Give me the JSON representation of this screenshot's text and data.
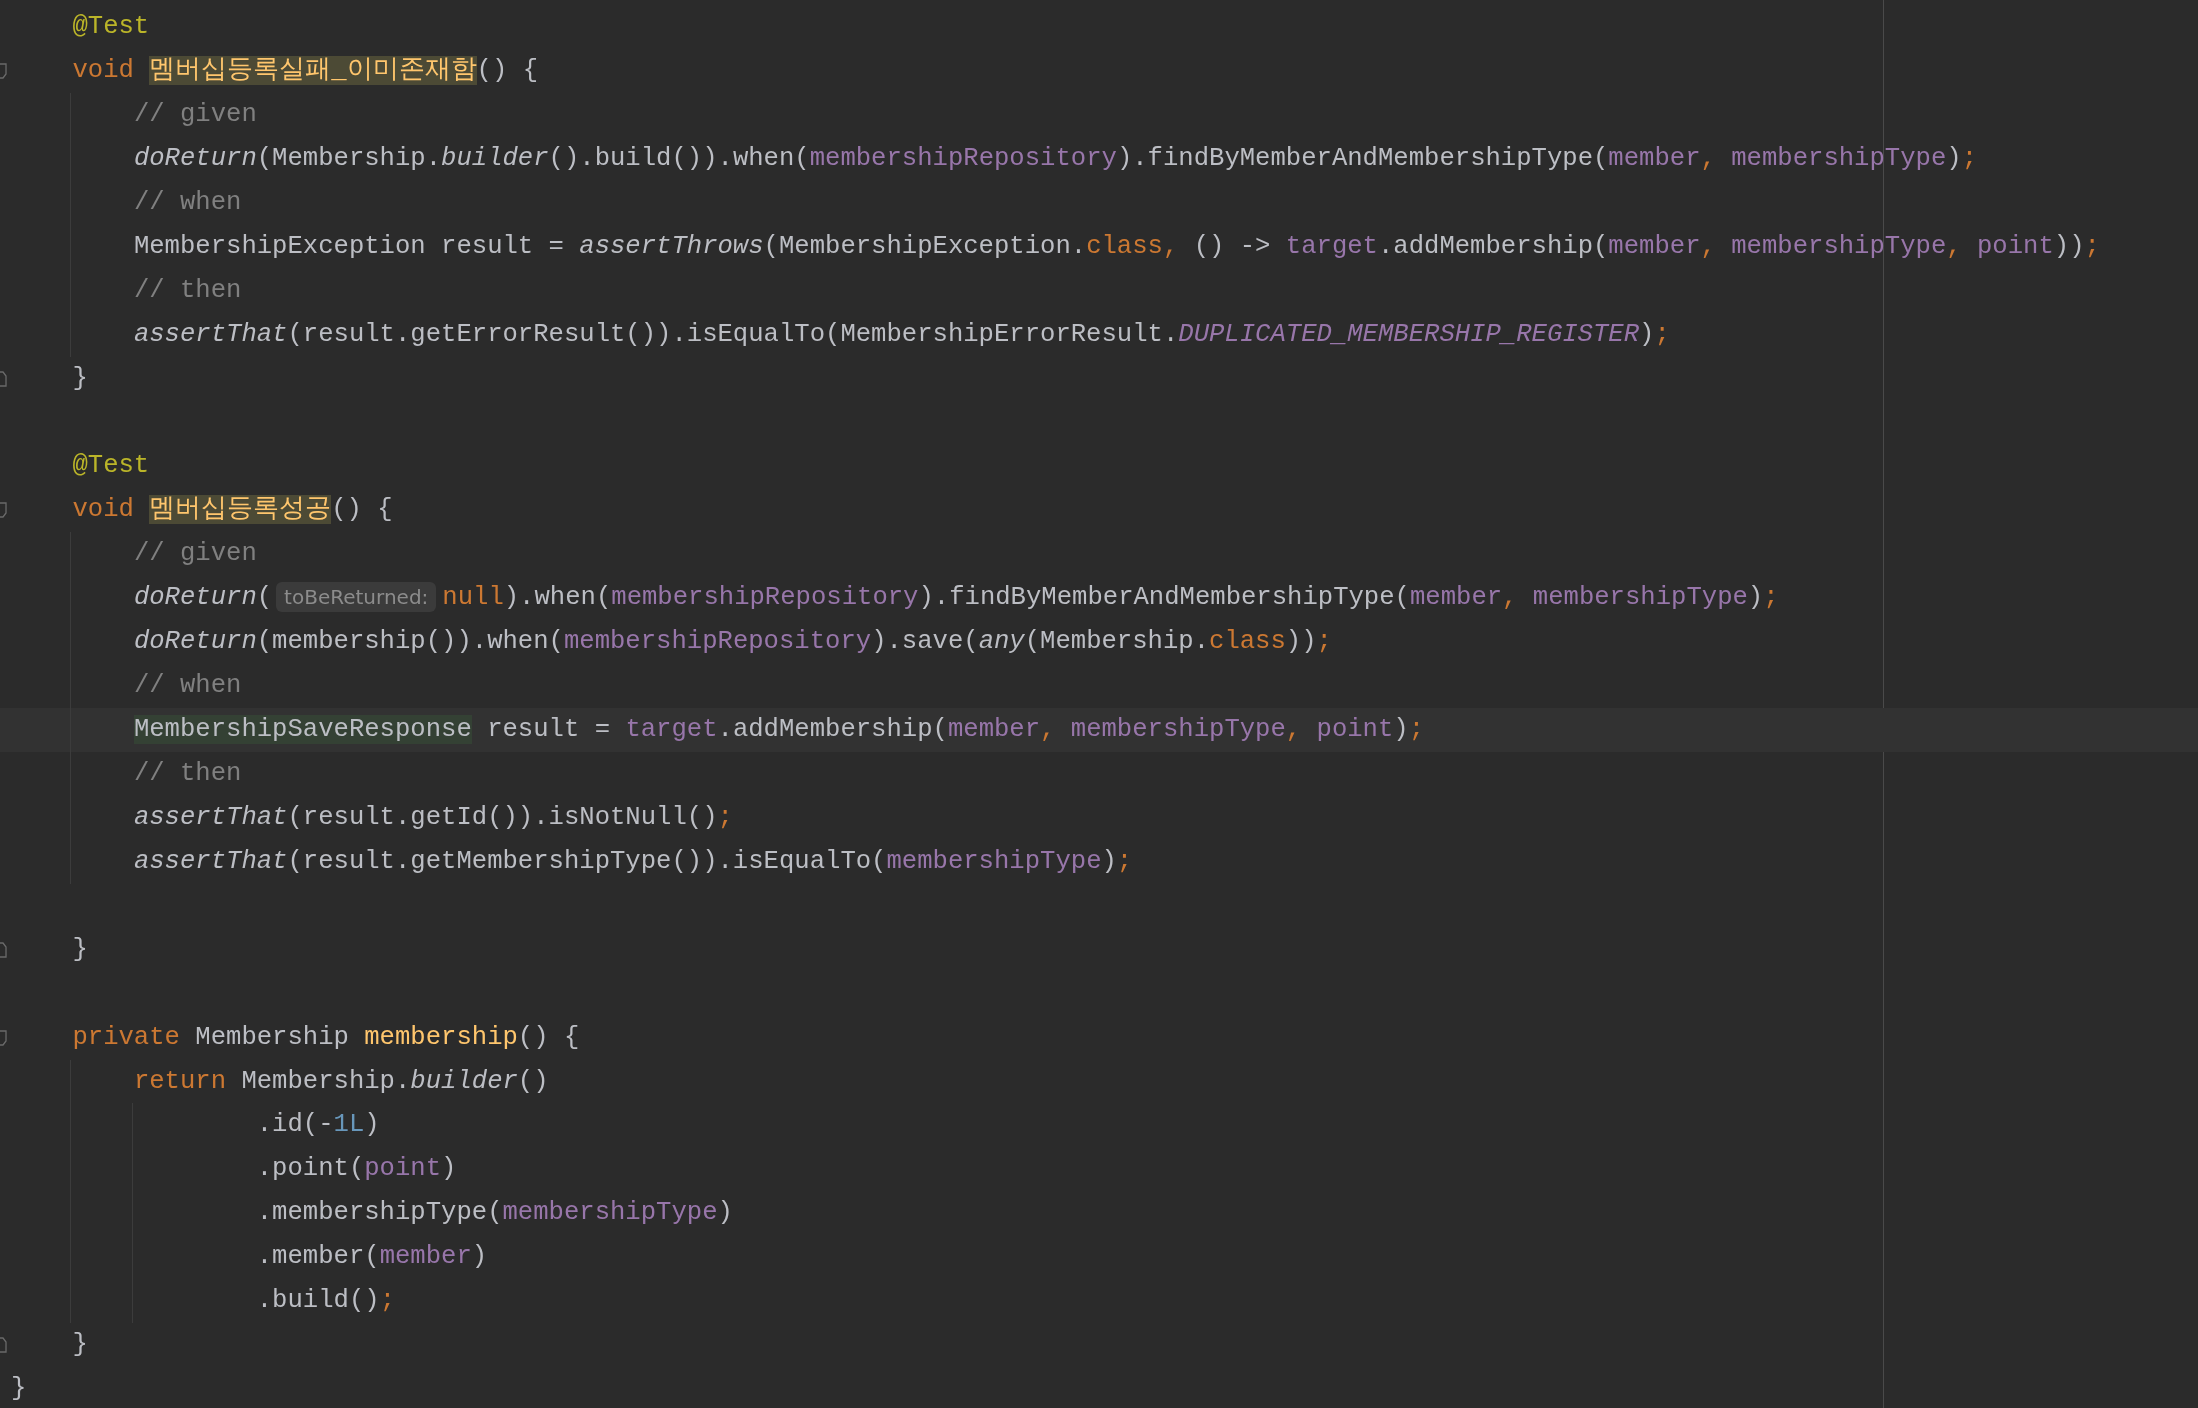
{
  "editor": {
    "lines": [
      {
        "kind": "code",
        "current": false,
        "tokens": [
          {
            "text": "    @Test",
            "kind": "annotation"
          }
        ]
      },
      {
        "kind": "fold-start",
        "current": false,
        "tokens": [
          {
            "text": "    void ",
            "kind": "keyword"
          },
          {
            "text": "멤버십등록실패_이미존재함",
            "kind": "name-highlight"
          },
          {
            "text": "() {",
            "kind": "plain"
          }
        ]
      },
      {
        "kind": "code",
        "current": false,
        "tokens": [
          {
            "text": "        // given",
            "kind": "comment"
          }
        ]
      },
      {
        "kind": "code",
        "current": false,
        "tokens": [
          {
            "text": "        doReturn",
            "kind": "italic"
          },
          {
            "text": "(Membership.",
            "kind": "plain"
          },
          {
            "text": "builder",
            "kind": "italic"
          },
          {
            "text": "().build()).when(",
            "kind": "plain"
          },
          {
            "text": "membershipRepository",
            "kind": "field"
          },
          {
            "text": ").findByMemberAndMembershipType(",
            "kind": "plain"
          },
          {
            "text": "member",
            "kind": "field"
          },
          {
            "text": ", ",
            "kind": "keyword"
          },
          {
            "text": "membershipType",
            "kind": "field"
          },
          {
            "text": ")",
            "kind": "plain"
          },
          {
            "text": ";",
            "kind": "keyword"
          }
        ]
      },
      {
        "kind": "code",
        "current": false,
        "tokens": [
          {
            "text": "        // when",
            "kind": "comment"
          }
        ]
      },
      {
        "kind": "code",
        "current": false,
        "tokens": [
          {
            "text": "        MembershipException result = ",
            "kind": "plain"
          },
          {
            "text": "assertThrows",
            "kind": "italic"
          },
          {
            "text": "(MembershipException.",
            "kind": "plain"
          },
          {
            "text": "class, ",
            "kind": "keyword"
          },
          {
            "text": "() -> ",
            "kind": "plain"
          },
          {
            "text": "target",
            "kind": "field"
          },
          {
            "text": ".addMembership(",
            "kind": "plain"
          },
          {
            "text": "member",
            "kind": "field"
          },
          {
            "text": ", ",
            "kind": "keyword"
          },
          {
            "text": "membershipType",
            "kind": "field"
          },
          {
            "text": ", ",
            "kind": "keyword"
          },
          {
            "text": "point",
            "kind": "field"
          },
          {
            "text": "))",
            "kind": "plain"
          },
          {
            "text": ";",
            "kind": "keyword"
          }
        ]
      },
      {
        "kind": "code",
        "current": false,
        "tokens": [
          {
            "text": "        // then",
            "kind": "comment"
          }
        ]
      },
      {
        "kind": "code",
        "current": false,
        "tokens": [
          {
            "text": "        assertThat",
            "kind": "italic"
          },
          {
            "text": "(result.getErrorResult()).isEqualTo(MembershipErrorResult.",
            "kind": "plain"
          },
          {
            "text": "DUPLICATED_MEMBERSHIP_REGISTER",
            "kind": "const"
          },
          {
            "text": ")",
            "kind": "plain"
          },
          {
            "text": ";",
            "kind": "keyword"
          }
        ]
      },
      {
        "kind": "fold-end",
        "current": false,
        "tokens": [
          {
            "text": "    }",
            "kind": "plain"
          }
        ]
      },
      {
        "kind": "blank",
        "current": false
      },
      {
        "kind": "code",
        "current": false,
        "tokens": [
          {
            "text": "    @Test",
            "kind": "annotation"
          }
        ]
      },
      {
        "kind": "fold-start",
        "current": false,
        "tokens": [
          {
            "text": "    void ",
            "kind": "keyword"
          },
          {
            "text": "멤버십등록성공",
            "kind": "name-highlight"
          },
          {
            "text": "() {",
            "kind": "plain"
          }
        ]
      },
      {
        "kind": "code",
        "current": false,
        "tokens": [
          {
            "text": "        // given",
            "kind": "comment"
          }
        ]
      },
      {
        "kind": "code",
        "current": false,
        "tokens": [
          {
            "text": "        doReturn",
            "kind": "italic"
          },
          {
            "text": "(",
            "kind": "plain"
          },
          {
            "text": "toBeReturned:",
            "kind": "hint"
          },
          {
            "text": "null",
            "kind": "keyword"
          },
          {
            "text": ").when(",
            "kind": "plain"
          },
          {
            "text": "membershipRepository",
            "kind": "field"
          },
          {
            "text": ").findByMemberAndMembershipType(",
            "kind": "plain"
          },
          {
            "text": "member",
            "kind": "field"
          },
          {
            "text": ", ",
            "kind": "keyword"
          },
          {
            "text": "membershipType",
            "kind": "field"
          },
          {
            "text": ")",
            "kind": "plain"
          },
          {
            "text": ";",
            "kind": "keyword"
          }
        ]
      },
      {
        "kind": "code",
        "current": false,
        "tokens": [
          {
            "text": "        doReturn",
            "kind": "italic"
          },
          {
            "text": "(membership()).when(",
            "kind": "plain"
          },
          {
            "text": "membershipRepository",
            "kind": "field"
          },
          {
            "text": ").save(",
            "kind": "plain"
          },
          {
            "text": "any",
            "kind": "italic"
          },
          {
            "text": "(Membership.",
            "kind": "plain"
          },
          {
            "text": "class",
            "kind": "keyword"
          },
          {
            "text": "))",
            "kind": "plain"
          },
          {
            "text": ";",
            "kind": "keyword"
          }
        ]
      },
      {
        "kind": "code",
        "current": false,
        "tokens": [
          {
            "text": "        // when",
            "kind": "comment"
          }
        ]
      },
      {
        "kind": "code",
        "current": true,
        "tokens": [
          {
            "text": "        MembershipSaveResponse",
            "kind": "usage"
          },
          {
            "text": " result = ",
            "kind": "plain"
          },
          {
            "text": "target",
            "kind": "field"
          },
          {
            "text": ".addMembership(",
            "kind": "plain"
          },
          {
            "text": "member",
            "kind": "field"
          },
          {
            "text": ", ",
            "kind": "keyword"
          },
          {
            "text": "membershipType",
            "kind": "field"
          },
          {
            "text": ", ",
            "kind": "keyword"
          },
          {
            "text": "point",
            "kind": "field"
          },
          {
            "text": ")",
            "kind": "plain"
          },
          {
            "text": ";",
            "kind": "keyword"
          }
        ]
      },
      {
        "kind": "code",
        "current": false,
        "tokens": [
          {
            "text": "        // then",
            "kind": "comment"
          }
        ]
      },
      {
        "kind": "code",
        "current": false,
        "tokens": [
          {
            "text": "        assertThat",
            "kind": "italic"
          },
          {
            "text": "(result.getId()).isNotNull()",
            "kind": "plain"
          },
          {
            "text": ";",
            "kind": "keyword"
          }
        ]
      },
      {
        "kind": "code",
        "current": false,
        "tokens": [
          {
            "text": "        assertThat",
            "kind": "italic"
          },
          {
            "text": "(result.getMembershipType()).isEqualTo(",
            "kind": "plain"
          },
          {
            "text": "membershipType",
            "kind": "field"
          },
          {
            "text": ")",
            "kind": "plain"
          },
          {
            "text": ";",
            "kind": "keyword"
          }
        ]
      },
      {
        "kind": "blank",
        "current": false
      },
      {
        "kind": "fold-end",
        "current": false,
        "tokens": [
          {
            "text": "    }",
            "kind": "plain"
          }
        ]
      },
      {
        "kind": "blank",
        "current": false
      },
      {
        "kind": "fold-start",
        "current": false,
        "tokens": [
          {
            "text": "    private",
            "kind": "keyword"
          },
          {
            "text": " Membership ",
            "kind": "plain"
          },
          {
            "text": "membership",
            "kind": "decl"
          },
          {
            "text": "() {",
            "kind": "plain"
          }
        ]
      },
      {
        "kind": "code",
        "current": false,
        "tokens": [
          {
            "text": "        return",
            "kind": "keyword"
          },
          {
            "text": " Membership.",
            "kind": "plain"
          },
          {
            "text": "builder",
            "kind": "italic"
          },
          {
            "text": "()",
            "kind": "plain"
          }
        ]
      },
      {
        "kind": "code",
        "current": false,
        "tokens": [
          {
            "text": "                .id(-",
            "kind": "plain"
          },
          {
            "text": "1L",
            "kind": "number"
          },
          {
            "text": ")",
            "kind": "plain"
          }
        ]
      },
      {
        "kind": "code",
        "current": false,
        "tokens": [
          {
            "text": "                .point(",
            "kind": "plain"
          },
          {
            "text": "point",
            "kind": "field"
          },
          {
            "text": ")",
            "kind": "plain"
          }
        ]
      },
      {
        "kind": "code",
        "current": false,
        "tokens": [
          {
            "text": "                .membershipType(",
            "kind": "plain"
          },
          {
            "text": "membershipType",
            "kind": "field"
          },
          {
            "text": ")",
            "kind": "plain"
          }
        ]
      },
      {
        "kind": "code",
        "current": false,
        "tokens": [
          {
            "text": "                .member(",
            "kind": "plain"
          },
          {
            "text": "member",
            "kind": "field"
          },
          {
            "text": ")",
            "kind": "plain"
          }
        ]
      },
      {
        "kind": "code",
        "current": false,
        "tokens": [
          {
            "text": "                .build()",
            "kind": "plain"
          },
          {
            "text": ";",
            "kind": "keyword"
          }
        ]
      },
      {
        "kind": "fold-end",
        "current": false,
        "tokens": [
          {
            "text": "    }",
            "kind": "plain"
          }
        ]
      },
      {
        "kind": "code",
        "current": false,
        "tokens": [
          {
            "text": "}",
            "kind": "plain"
          }
        ]
      }
    ]
  }
}
